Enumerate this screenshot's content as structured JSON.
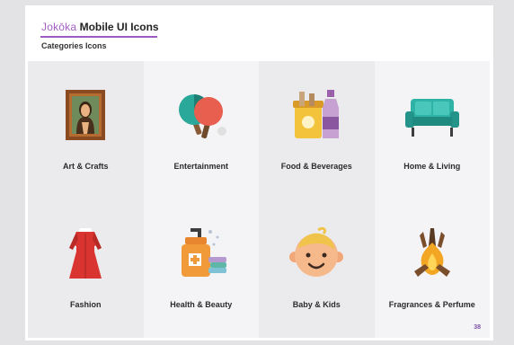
{
  "header": {
    "brand_logo": "Jokōka",
    "brand_title": "Mobile UI Icons",
    "subtitle": "Categories Icons"
  },
  "colors": {
    "accent": "#9b5bc0",
    "tile_light": "#f4f4f6",
    "tile_dark": "#ebebed"
  },
  "categories": [
    {
      "label": "Art & Crafts",
      "icon": "painting-icon"
    },
    {
      "label": "Entertainment",
      "icon": "ping-pong-icon"
    },
    {
      "label": "Food & Beverages",
      "icon": "jar-and-bottle-icon"
    },
    {
      "label": "Home & Living",
      "icon": "sofa-icon"
    },
    {
      "label": "Fashion",
      "icon": "dress-icon"
    },
    {
      "label": "Health & Beauty",
      "icon": "soap-dispenser-icon"
    },
    {
      "label": "Baby & Kids",
      "icon": "baby-face-icon"
    },
    {
      "label": "Fragrances & Perfume",
      "icon": "incense-flame-icon"
    }
  ],
  "page_number": "38"
}
